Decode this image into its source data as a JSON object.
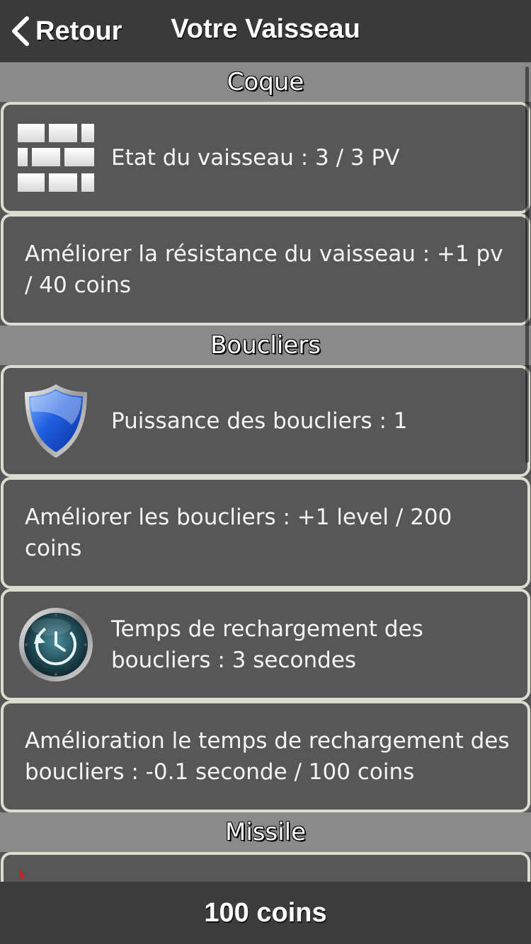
{
  "navbar": {
    "back_label": "Retour",
    "title": "Votre Vaisseau"
  },
  "sections": {
    "hull": {
      "header": "Coque",
      "status_text": "Etat du vaisseau : 3 / 3 PV",
      "status_icon": "brick-wall-icon",
      "upgrade_text": "Améliorer la résistance du vaisseau : +1 pv / 40 coins"
    },
    "shields": {
      "header": "Boucliers",
      "power_text": "Puissance des boucliers : 1",
      "power_icon": "blue-shield-icon",
      "upgrade_power_text": "Améliorer les boucliers : +1 level / 200 coins",
      "reload_text": "Temps de rechargement des boucliers : 3 secondes",
      "reload_icon": "time-machine-clock-icon",
      "upgrade_reload_text": "Amélioration le temps de rechargement des boucliers : -0.1 seconde / 100 coins"
    },
    "missile": {
      "header": "Missile",
      "partial_icon": "missile-icon"
    }
  },
  "footer": {
    "coins": "100 coins"
  },
  "colors": {
    "background": "#555555",
    "navbar": "#3a3a3a",
    "section_header": "#8a8a8a",
    "cell_border": "#dcdcd0",
    "footer": "#3c3c3c"
  }
}
